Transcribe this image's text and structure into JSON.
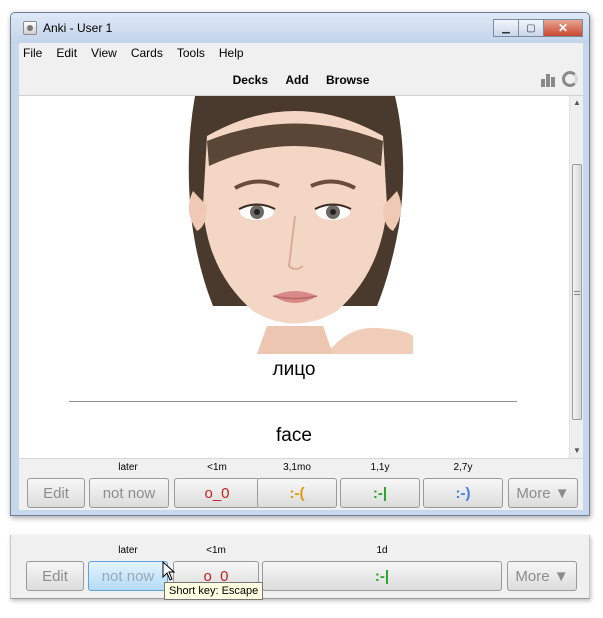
{
  "window": {
    "title": "Anki - User 1"
  },
  "menu": [
    "File",
    "Edit",
    "View",
    "Cards",
    "Tools",
    "Help"
  ],
  "toolbar": {
    "links": [
      "Decks",
      "Add",
      "Browse"
    ]
  },
  "card": {
    "front": "лицо",
    "back": "face"
  },
  "answer_bar": {
    "edit_label": "Edit",
    "bury_interval": "later",
    "bury_label": "not now",
    "more_label": "More ▼",
    "buttons": [
      {
        "interval": "<1m",
        "label": "o_0",
        "color": "#c31f1f"
      },
      {
        "interval": "3,1mo",
        "label": ":-(",
        "color": "#e29a00"
      },
      {
        "interval": "1,1y",
        "label": ":-|",
        "color": "#27a327"
      },
      {
        "interval": "2,7y",
        "label": ":-)",
        "color": "#3c7ee6"
      }
    ]
  },
  "answer_bar_2": {
    "edit_label": "Edit",
    "bury_interval": "later",
    "bury_label": "not now",
    "more_label": "More ▼",
    "buttons": [
      {
        "interval": "<1m",
        "label": "o_0",
        "color": "#c31f1f"
      },
      {
        "interval": "1d",
        "label": ":-|",
        "color": "#27a327"
      }
    ],
    "tooltip": "Short key: Escape"
  }
}
